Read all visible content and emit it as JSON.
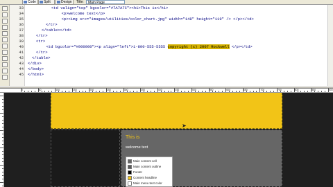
{
  "toolbar": {
    "code_label": "Code",
    "split_label": "Split",
    "design_label": "Design",
    "title_label": "Title:",
    "title_value": "Main Page"
  },
  "code": {
    "line_numbers": [
      "33",
      "34",
      "35",
      "36",
      "37",
      "38",
      "39",
      "40",
      "41",
      "42",
      "43",
      "44",
      "45"
    ],
    "lines": [
      "<td valign=\"top\" bgcolor=\"#7A7A7C\"><h1>This is</h1>",
      "  <p>welcome text</p>",
      "  <p><img src=\"images/utilities/color_chart.jpg\" width=\"148\" height=\"119\" /> </p></td>",
      "</tr>",
      "</table></td>",
      "</tr>",
      "<tr>",
      "  <td bgcolor=\"#000000\"><p align=\"left\">1-800-555-5555 ",
      "</tr>",
      "</table>",
      "</div>",
      "</body>",
      "</html>"
    ],
    "copyright_text": "copyright (c) 2007 Rockwell",
    "after_copyright": " </p></td>"
  },
  "ruler": {
    "labels": [
      "0",
      "50",
      "100",
      "150",
      "200",
      "250",
      "300",
      "350",
      "400",
      "450",
      "500",
      "550",
      "600",
      "650",
      "700",
      "750",
      "800",
      "850",
      "900"
    ]
  },
  "design": {
    "heading": "This is",
    "welcome": "welcome text",
    "legend": [
      {
        "label": "Main content cell",
        "color": "#666666"
      },
      {
        "label": "Main content outline",
        "color": "#5a5a5a"
      },
      {
        "label": "Footer",
        "color": "#000000"
      },
      {
        "label": "Content headline",
        "color": "#f2c417"
      },
      {
        "label": "Main menu text color",
        "color": "#ffffff"
      }
    ]
  },
  "colors": {
    "header_yellow": "#f2c417",
    "page_background": "#1f1f1f",
    "content_gray": "#666666"
  }
}
